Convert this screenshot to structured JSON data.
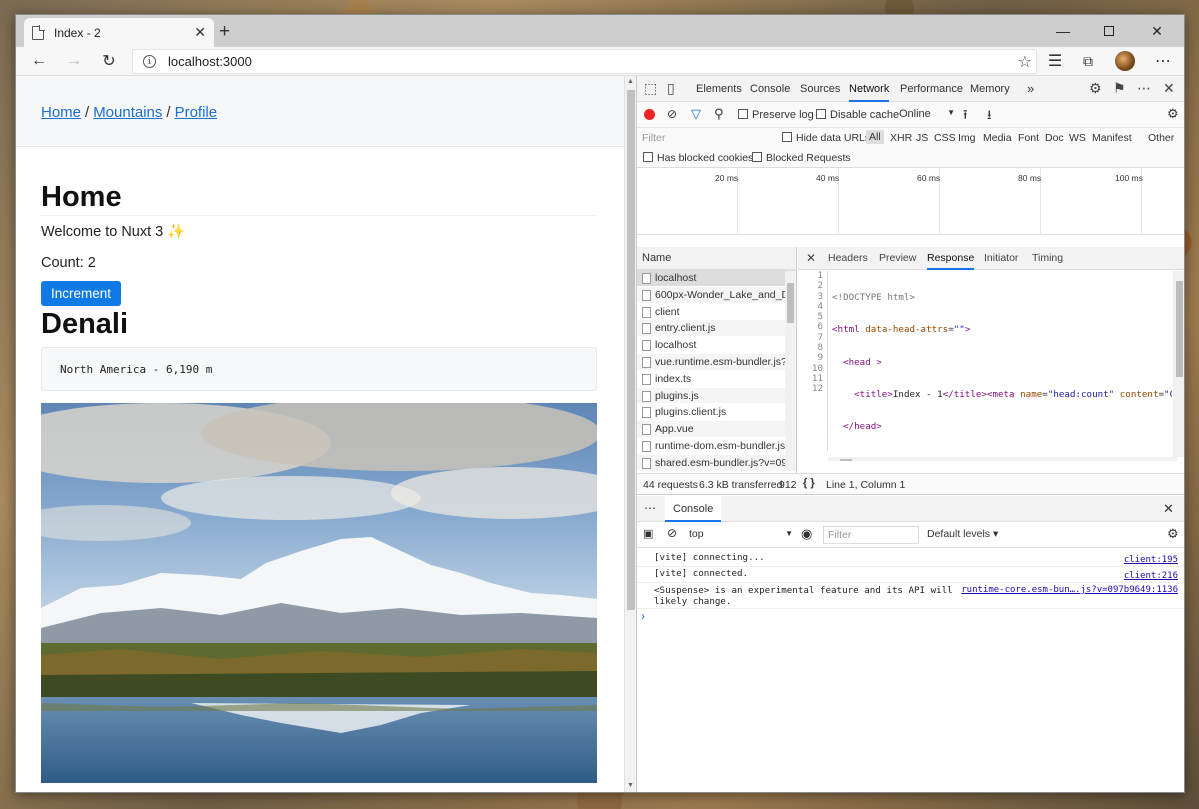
{
  "browser": {
    "tab_title": "Index - 2",
    "tab_close": "✕",
    "new_tab": "+",
    "address": "localhost:3000",
    "icons": [
      "back-arrow-icon",
      "forward-arrow-icon",
      "reload-icon",
      "star-icon",
      "favorites-icon",
      "collections-icon",
      "more-icon"
    ]
  },
  "page": {
    "breadcrumb": [
      "Home",
      "Mountains",
      "Profile"
    ],
    "breadcrumb_sep": "/",
    "heading": "Home",
    "welcome": "Welcome to Nuxt 3 ✨",
    "count_text": "Count: 2",
    "increment_label": "Increment",
    "mountain_title": "Denali",
    "mountain_info": "North America - 6,190 m"
  },
  "devtools": {
    "tabs": [
      "Elements",
      "Console",
      "Sources",
      "Network",
      "Performance",
      "Memory"
    ],
    "active_tab": "Network",
    "more": "»",
    "network": {
      "preserve_log": "Preserve log",
      "disable_cache": "Disable cache",
      "throttling": "Online",
      "filter_placeholder": "Filter",
      "hide_data_urls": "Hide data URLs",
      "type_filters": [
        "All",
        "XHR",
        "JS",
        "CSS",
        "Img",
        "Media",
        "Font",
        "Doc",
        "WS",
        "Manifest",
        "Other"
      ],
      "has_blocked_cookies": "Has blocked cookies",
      "blocked_requests": "Blocked Requests",
      "timeline_labels": [
        "20 ms",
        "40 ms",
        "60 ms",
        "80 ms",
        "100 ms"
      ],
      "name_header": "Name",
      "requests": [
        "localhost",
        "600px-Wonder_Lake_and_Der",
        "client",
        "entry.client.js",
        "localhost",
        "vue.runtime.esm-bundler.js?v.",
        "index.ts",
        "plugins.js",
        "plugins.client.js",
        "App.vue",
        "runtime-dom.esm-bundler.js?",
        "shared.esm-bundler.js?v=097."
      ],
      "detail_tabs": [
        "Headers",
        "Preview",
        "Response",
        "Initiator",
        "Timing"
      ],
      "active_detail_tab": "Response",
      "line_numbers": [
        "1",
        "2",
        "3",
        "4",
        "5",
        "6",
        "7",
        "8",
        "9",
        "10",
        "11",
        "12"
      ],
      "status_requests": "44 requests",
      "status_transferred": "6.3 kB transferred",
      "status_more": "912",
      "cursor_pos": "Line 1, Column 1",
      "pretty_print": "{ }"
    },
    "console": {
      "drawer_tab": "Console",
      "context": "top",
      "filter_placeholder": "Filter",
      "levels": "Default levels ▾",
      "messages": [
        {
          "text": "[vite] connecting...",
          "source": "client:195"
        },
        {
          "text": "[vite] connected.",
          "source": "client:216"
        },
        {
          "text": "<Suspense> is an experimental feature and its API will likely change.",
          "source": "runtime-core.esm-bun….js?v=097b9649:1136"
        }
      ],
      "prompt": "›"
    }
  }
}
